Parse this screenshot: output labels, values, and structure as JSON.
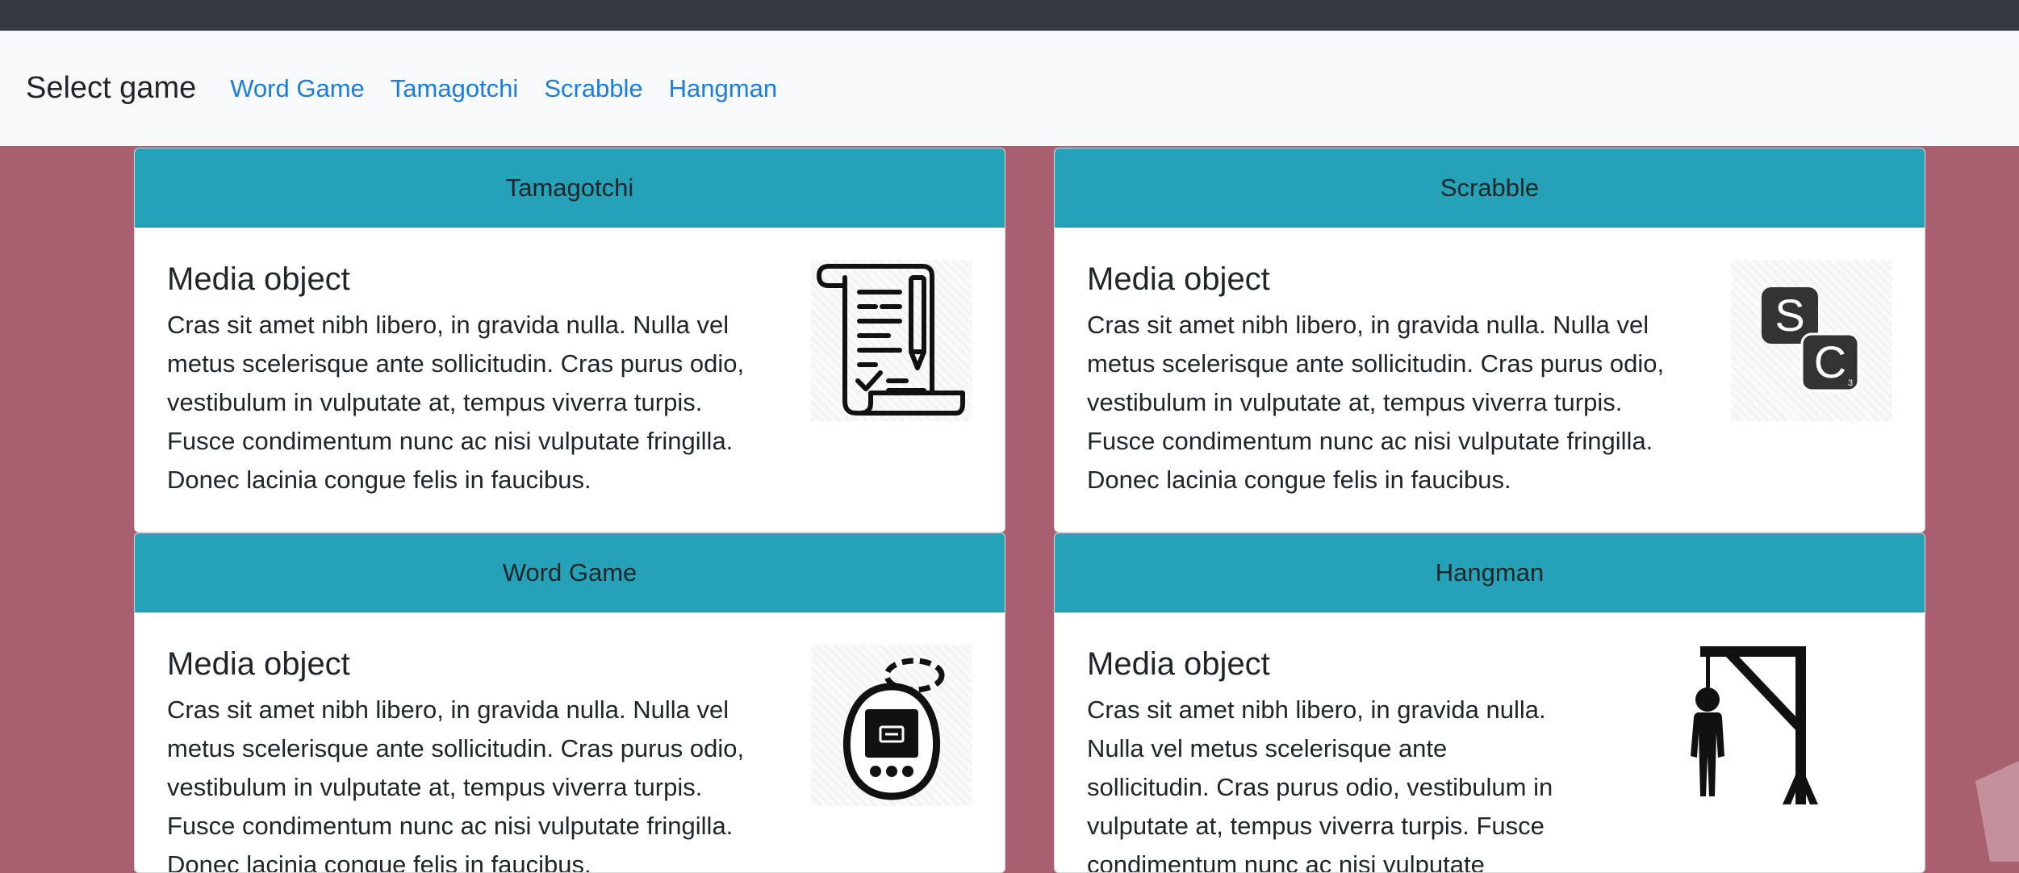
{
  "navbar": {
    "brand": "Select game",
    "links": [
      "Word Game",
      "Tamagotchi",
      "Scrabble",
      "Hangman"
    ]
  },
  "cards": [
    {
      "header": "Tamagotchi",
      "title": "Media object",
      "text": "Cras sit amet nibh libero, in gravida nulla. Nulla vel metus scelerisque ante sollicitudin. Cras purus odio, vestibulum in vulputate at, tempus viverra turpis. Fusce condimentum nunc ac nisi vulputate fringilla. Donec lacinia congue felis in faucibus.",
      "icon": "scroll-checklist-icon"
    },
    {
      "header": "Scrabble",
      "title": "Media object",
      "text": "Cras sit amet nibh libero, in gravida nulla. Nulla vel metus scelerisque ante sollicitudin. Cras purus odio, vestibulum in vulputate at, tempus viverra turpis. Fusce condimentum nunc ac nisi vulputate fringilla. Donec lacinia congue felis in faucibus.",
      "icon": "scrabble-tiles-icon",
      "tiles": [
        {
          "letter": "S",
          "score": "1"
        },
        {
          "letter": "C",
          "score": "3"
        }
      ]
    },
    {
      "header": "Word Game",
      "title": "Media object",
      "text": "Cras sit amet nibh libero, in gravida nulla. Nulla vel metus scelerisque ante sollicitudin. Cras purus odio, vestibulum in vulputate at, tempus viverra turpis. Fusce condimentum nunc ac nisi vulputate fringilla. Donec lacinia congue felis in faucibus.",
      "icon": "tamagotchi-icon"
    },
    {
      "header": "Hangman",
      "title": "Media object",
      "text": "Cras sit amet nibh libero, in gravida nulla. Nulla vel metus scelerisque ante sollicitudin. Cras purus odio, vestibulum in vulputate at, tempus viverra turpis. Fusce condimentum nunc ac nisi vulputate",
      "icon": "hangman-icon"
    }
  ],
  "colors": {
    "background": "#a86070",
    "topbar": "#343a40",
    "navbar": "#f8f9fa",
    "link": "#1a7ee0",
    "card_header": "#25a2b8"
  }
}
